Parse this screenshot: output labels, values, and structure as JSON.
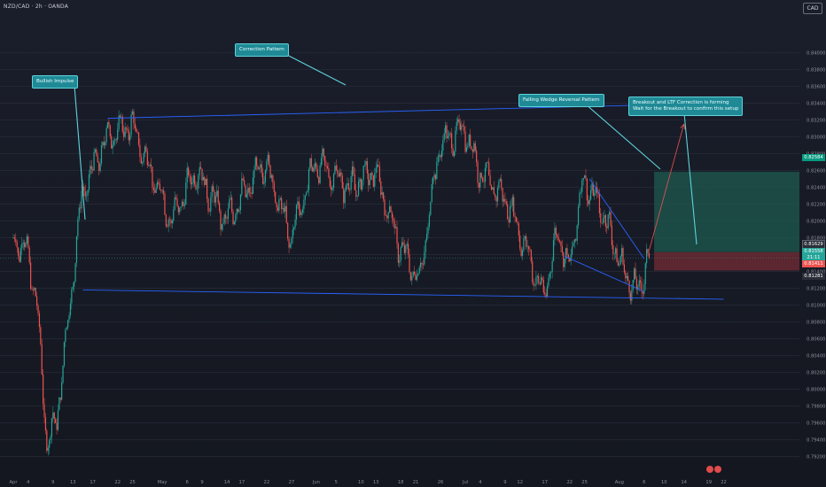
{
  "header": {
    "symbol": "NZD/CAD · 2h · OANDA",
    "currency_button": "CAD"
  },
  "colors": {
    "background": "#161a25",
    "up": "#26a69a",
    "down": "#ef5350",
    "trendline": "#2962ff",
    "annotation_fill": "#1f8a96",
    "target_zone": "#1e5a4f",
    "stop_zone": "#6e2a33"
  },
  "annotations": {
    "bullish": "Bullish Impulse",
    "correction": "Correction Pattern",
    "wedge": "Falling Wedge Reversal Pattern",
    "breakout_line1": "Breakout and LTF Correction is forming",
    "breakout_line2": "Wait for the Breakout to confirm this setup"
  },
  "price_tags": {
    "target": "0.82584",
    "entry": "0.81629",
    "current": "0.81558",
    "countdown": "21:11",
    "stop": "0.81411",
    "low": "0.81281"
  },
  "chart_data": {
    "type": "candlestick",
    "ylim": [
      0.7908,
      0.845
    ],
    "y_ticks": [
      "0.84000",
      "0.83800",
      "0.83600",
      "0.83400",
      "0.83200",
      "0.83000",
      "0.82800",
      "0.82600",
      "0.82400",
      "0.82200",
      "0.82000",
      "0.81800",
      "0.81600",
      "0.81400",
      "0.81200",
      "0.81000",
      "0.80800",
      "0.80600",
      "0.80400",
      "0.80200",
      "0.80000",
      "0.79800",
      "0.79600",
      "0.79400",
      "0.79200"
    ],
    "x_ticks": [
      "Apr",
      "4",
      "9",
      "13",
      "17",
      "22",
      "25",
      "May",
      "6",
      "9",
      "14",
      "17",
      "22",
      "27",
      "Jun",
      "5",
      "10",
      "13",
      "18",
      "21",
      "26",
      "Jul",
      "4",
      "9",
      "12",
      "17",
      "22",
      "25",
      "Aug",
      "6",
      "10",
      "14",
      "19",
      "22"
    ],
    "price_path": [
      {
        "date": "Apr 1",
        "price": 0.818
      },
      {
        "date": "Apr 4",
        "price": 0.8165
      },
      {
        "date": "Apr 6",
        "price": 0.81
      },
      {
        "date": "Apr 8",
        "price": 0.7935
      },
      {
        "date": "Apr 10",
        "price": 0.7965
      },
      {
        "date": "Apr 13",
        "price": 0.812
      },
      {
        "date": "Apr 15",
        "price": 0.823
      },
      {
        "date": "Apr 20",
        "price": 0.83
      },
      {
        "date": "Apr 25",
        "price": 0.8315
      },
      {
        "date": "May 3",
        "price": 0.82
      },
      {
        "date": "May 8",
        "price": 0.826
      },
      {
        "date": "May 14",
        "price": 0.82
      },
      {
        "date": "May 22",
        "price": 0.827
      },
      {
        "date": "May 27",
        "price": 0.818
      },
      {
        "date": "Jun 1",
        "price": 0.827
      },
      {
        "date": "Jun 8",
        "price": 0.824
      },
      {
        "date": "Jun 13",
        "price": 0.826
      },
      {
        "date": "Jun 18",
        "price": 0.817
      },
      {
        "date": "Jun 22",
        "price": 0.813
      },
      {
        "date": "Jun 26",
        "price": 0.829
      },
      {
        "date": "Jul 1",
        "price": 0.831
      },
      {
        "date": "Jul 4",
        "price": 0.826
      },
      {
        "date": "Jul 10",
        "price": 0.822
      },
      {
        "date": "Jul 17",
        "price": 0.811
      },
      {
        "date": "Jul 20",
        "price": 0.819
      },
      {
        "date": "Jul 22",
        "price": 0.814
      },
      {
        "date": "Jul 25",
        "price": 0.825
      },
      {
        "date": "Jul 29",
        "price": 0.821
      },
      {
        "date": "Aug 2",
        "price": 0.814
      },
      {
        "date": "Aug 5",
        "price": 0.8115
      },
      {
        "date": "Aug 7",
        "price": 0.8156
      }
    ],
    "lines": {
      "upper_channel": [
        {
          "date": "Apr 20",
          "price": 0.8322
        },
        {
          "date": "Aug 22",
          "price": 0.834
        }
      ],
      "lower_channel": [
        {
          "date": "Apr 15",
          "price": 0.8118
        },
        {
          "date": "Aug 22",
          "price": 0.8107
        }
      ],
      "wedge_upper": [
        {
          "date": "Jul 26",
          "price": 0.825
        },
        {
          "date": "Aug 6",
          "price": 0.8155
        }
      ],
      "wedge_lower": [
        {
          "date": "Jul 21",
          "price": 0.8158
        },
        {
          "date": "Aug 6",
          "price": 0.8116
        }
      ],
      "projection": [
        {
          "date": "Aug 7",
          "price": 0.8165
        },
        {
          "date": "Aug 14",
          "price": 0.8315
        }
      ]
    },
    "position": {
      "entry": 0.81629,
      "target": 0.82584,
      "stop": 0.81411
    }
  }
}
